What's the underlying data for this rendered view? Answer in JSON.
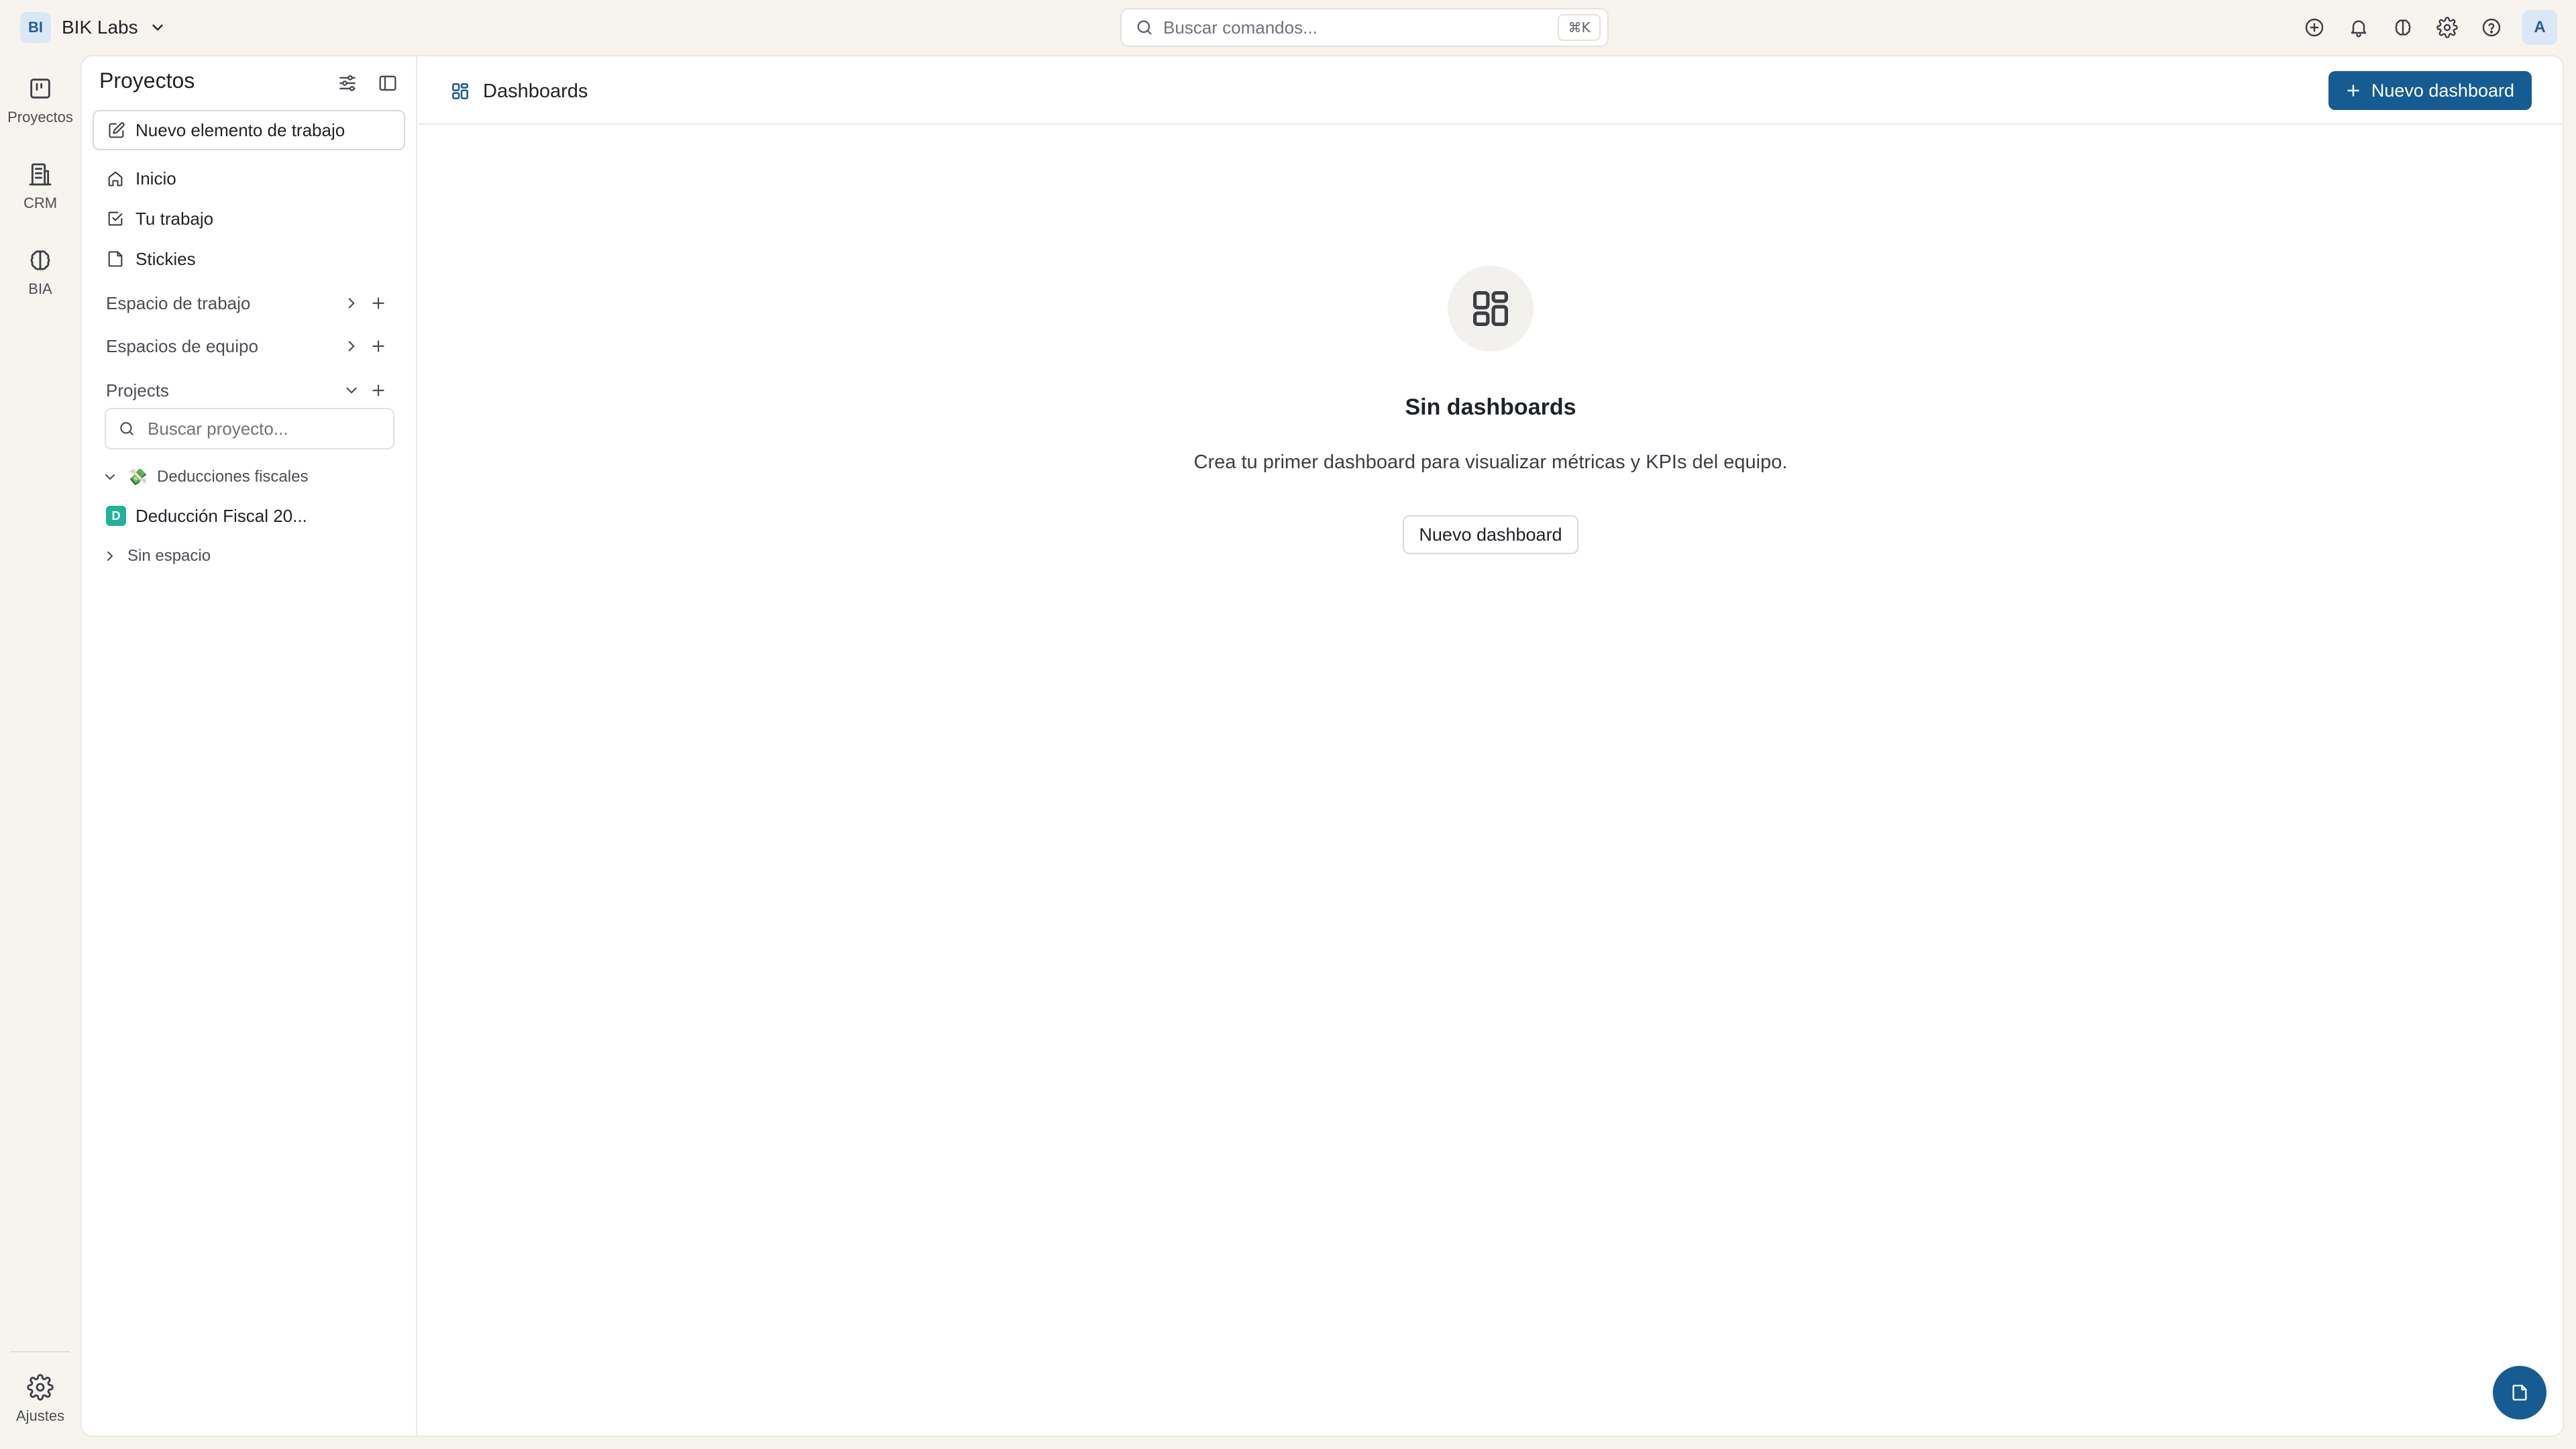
{
  "workspace": {
    "initials": "BI",
    "name": "BIK Labs"
  },
  "search": {
    "placeholder": "Buscar comandos...",
    "shortcut": "⌘K"
  },
  "header_actions": [
    {
      "icon": "add-circle-icon"
    },
    {
      "icon": "bell-icon"
    },
    {
      "icon": "brain-icon"
    },
    {
      "icon": "gear-icon"
    },
    {
      "icon": "help-icon"
    }
  ],
  "user": {
    "avatar_initial": "A"
  },
  "rail": {
    "items": [
      {
        "label": "Proyectos",
        "icon": "kanban-icon"
      },
      {
        "label": "CRM",
        "icon": "building-icon"
      },
      {
        "label": "BIA",
        "icon": "brain-icon"
      }
    ],
    "settings_label": "Ajustes"
  },
  "sidebar": {
    "title": "Proyectos",
    "new_item_label": "Nuevo elemento de trabajo",
    "nav": [
      {
        "label": "Inicio",
        "icon": "home-icon"
      },
      {
        "label": "Tu trabajo",
        "icon": "check-square-icon"
      },
      {
        "label": "Stickies",
        "icon": "sticky-note-icon"
      }
    ],
    "sections": {
      "workspace": "Espacio de trabajo",
      "team_spaces": "Espacios de equipo",
      "projects": "Projects"
    },
    "project_search_placeholder": "Buscar proyecto...",
    "tree": {
      "group_emoji": "💸",
      "group_label": "Deducciones fiscales",
      "project_badge": "D",
      "project_label": "Deducción Fiscal 20...",
      "no_space_label": "Sin espacio"
    }
  },
  "content": {
    "title": "Dashboards",
    "primary_button": "Nuevo dashboard",
    "empty_state": {
      "title": "Sin dashboards",
      "description": "Crea tu primer dashboard para visualizar métricas y KPIs del equipo.",
      "button": "Nuevo dashboard"
    }
  },
  "colors": {
    "accent": "#165c92",
    "background": "#f7f4f0",
    "panel": "#ffffff",
    "project_badge": "#20b39a"
  }
}
